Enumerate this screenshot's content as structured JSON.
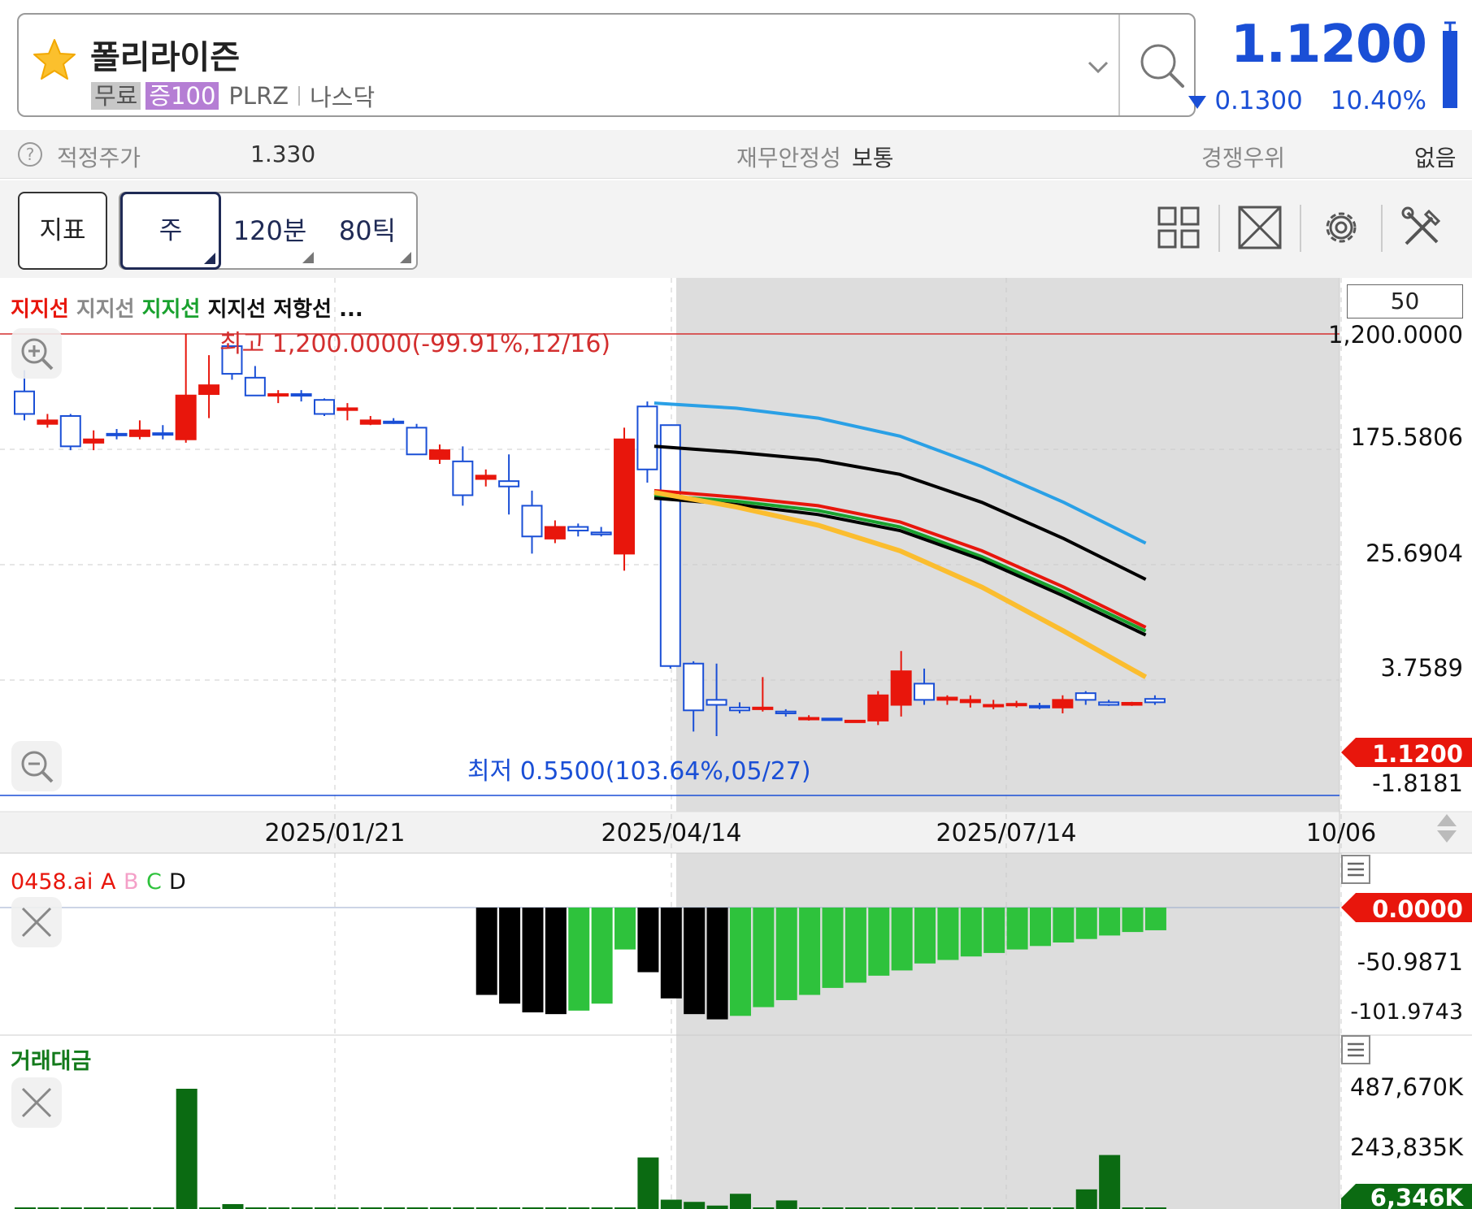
{
  "header": {
    "stock_name": "폴리라이즌",
    "tag_free": "무료",
    "tag_margin": "증100",
    "ticker": "PLRZ",
    "exchange": "나스닥",
    "price": "1.1200",
    "change": "0.1300",
    "change_pct": "10.40%",
    "price_color": "#1a4fd6"
  },
  "info_bar": {
    "fair_price_label": "적정주가",
    "fair_price_value": "1.330",
    "stability_label": "재무안정성",
    "stability_value": "보통",
    "competitive_label": "경쟁우위",
    "competitive_value": "없음"
  },
  "toolbar": {
    "indicator_label": "지표",
    "period_week": "주",
    "period_120min": "120분",
    "period_80tick": "80틱"
  },
  "chart": {
    "legend": [
      {
        "text": "지지선",
        "color": "#e8160c"
      },
      {
        "text": "지지선",
        "color": "#8a8a8a"
      },
      {
        "text": "지지선",
        "color": "#19a12e"
      },
      {
        "text": "지지선",
        "color": "#111111"
      },
      {
        "text": "저항선",
        "color": "#111111"
      },
      {
        "text": "...",
        "color": "#111111"
      }
    ],
    "ma_period": "50",
    "high_label": "최고 1,200.0000(-99.91%,12/16)",
    "low_label": "최저 0.5500(103.64%,05/27)",
    "y_labels": [
      "1,200.0000",
      "175.5806",
      "25.6904",
      "3.7589",
      "-1.8181"
    ],
    "current_price_tag": "1.1200",
    "x_labels": [
      "2025/01/21",
      "2025/04/14",
      "2025/07/14",
      "10/06"
    ]
  },
  "indicator_panel": {
    "name": "0458.ai",
    "series": [
      {
        "text": "A",
        "color": "#e8160c"
      },
      {
        "text": "B",
        "color": "#f4a0c8"
      },
      {
        "text": "C",
        "color": "#2ec23c"
      },
      {
        "text": "D",
        "color": "#111111"
      }
    ],
    "value_tag": "0.0000",
    "y_labels": [
      "-50.9871",
      "-101.9743"
    ]
  },
  "volume_panel": {
    "name": "거래대금",
    "y_labels": [
      "487,670K",
      "243,835K"
    ],
    "value_tag": "6,346K"
  },
  "chart_data": {
    "type": "bar",
    "title": "",
    "y_scale": "log",
    "candles": [
      {
        "o": 400,
        "h": 600,
        "l": 230,
        "c": 260,
        "up": false
      },
      {
        "o": 230,
        "h": 260,
        "l": 200,
        "c": 215,
        "up": true
      },
      {
        "o": 250,
        "h": 260,
        "l": 130,
        "c": 140,
        "up": false
      },
      {
        "o": 160,
        "h": 190,
        "l": 130,
        "c": 150,
        "up": true
      },
      {
        "o": 175,
        "h": 195,
        "l": 160,
        "c": 178,
        "up": false
      },
      {
        "o": 170,
        "h": 230,
        "l": 160,
        "c": 190,
        "up": true
      },
      {
        "o": 178,
        "h": 210,
        "l": 160,
        "c": 180,
        "up": false
      },
      {
        "o": 160,
        "h": 1200,
        "l": 150,
        "c": 370,
        "up": true
      },
      {
        "o": 380,
        "h": 800,
        "l": 240,
        "c": 450,
        "up": true
      },
      {
        "o": 560,
        "h": 800,
        "l": 500,
        "c": 950,
        "up": false
      },
      {
        "o": 520,
        "h": 650,
        "l": 420,
        "c": 370,
        "up": false
      },
      {
        "o": 380,
        "h": 410,
        "l": 320,
        "c": 370,
        "up": true
      },
      {
        "o": 380,
        "h": 410,
        "l": 330,
        "c": 375,
        "up": false
      },
      {
        "o": 340,
        "h": 350,
        "l": 250,
        "c": 260,
        "up": false
      },
      {
        "o": 280,
        "h": 320,
        "l": 230,
        "c": 290,
        "up": true
      },
      {
        "o": 230,
        "h": 250,
        "l": 210,
        "c": 215,
        "up": true
      },
      {
        "o": 225,
        "h": 240,
        "l": 215,
        "c": 222,
        "up": false
      },
      {
        "o": 200,
        "h": 215,
        "l": 120,
        "c": 120,
        "up": false
      },
      {
        "o": 130,
        "h": 145,
        "l": 100,
        "c": 110,
        "up": true
      },
      {
        "o": 105,
        "h": 140,
        "l": 45,
        "c": 55,
        "up": false
      },
      {
        "o": 80,
        "h": 90,
        "l": 65,
        "c": 75,
        "up": true
      },
      {
        "o": 72,
        "h": 120,
        "l": 38,
        "c": 65,
        "up": false
      },
      {
        "o": 45,
        "h": 60,
        "l": 18,
        "c": 25,
        "up": false
      },
      {
        "o": 30,
        "h": 34,
        "l": 22,
        "c": 24,
        "up": true
      },
      {
        "o": 30,
        "h": 32,
        "l": 25,
        "c": 28,
        "up": false
      },
      {
        "o": 27,
        "h": 30,
        "l": 25,
        "c": 26,
        "up": false
      },
      {
        "o": 18,
        "h": 200,
        "l": 13,
        "c": 160,
        "up": true
      },
      {
        "o": 90,
        "h": 330,
        "l": 70,
        "c": 300,
        "up": false
      },
      {
        "o": 210,
        "h": 210,
        "l": 2.0,
        "c": 2.1,
        "up": false
      },
      {
        "o": 2.2,
        "h": 2.3,
        "l": 0.6,
        "c": 0.9,
        "up": false
      },
      {
        "o": 1.1,
        "h": 2.2,
        "l": 0.55,
        "c": 1.0,
        "up": false
      },
      {
        "o": 0.95,
        "h": 1.05,
        "l": 0.85,
        "c": 0.9,
        "up": false
      },
      {
        "o": 0.95,
        "h": 1.7,
        "l": 0.88,
        "c": 0.92,
        "up": true
      },
      {
        "o": 0.85,
        "h": 0.92,
        "l": 0.8,
        "c": 0.88,
        "up": false
      },
      {
        "o": 0.78,
        "h": 0.82,
        "l": 0.74,
        "c": 0.76,
        "up": true
      },
      {
        "o": 0.76,
        "h": 0.78,
        "l": 0.74,
        "c": 0.77,
        "up": false
      },
      {
        "o": 0.74,
        "h": 0.75,
        "l": 0.72,
        "c": 0.74,
        "up": true
      },
      {
        "o": 0.74,
        "h": 1.3,
        "l": 0.68,
        "c": 1.2,
        "up": true
      },
      {
        "o": 1.0,
        "h": 2.8,
        "l": 0.8,
        "c": 1.9,
        "up": true
      },
      {
        "o": 1.5,
        "h": 2.0,
        "l": 1.0,
        "c": 1.1,
        "up": false
      },
      {
        "o": 1.1,
        "h": 1.2,
        "l": 1.0,
        "c": 1.15,
        "up": true
      },
      {
        "o": 1.05,
        "h": 1.2,
        "l": 0.95,
        "c": 1.1,
        "up": true
      },
      {
        "o": 1.0,
        "h": 1.1,
        "l": 0.92,
        "c": 1.0,
        "up": true
      },
      {
        "o": 1.0,
        "h": 1.08,
        "l": 0.95,
        "c": 1.02,
        "up": true
      },
      {
        "o": 0.98,
        "h": 1.04,
        "l": 0.92,
        "c": 0.95,
        "up": false
      },
      {
        "o": 0.95,
        "h": 1.2,
        "l": 0.85,
        "c": 1.1,
        "up": true
      },
      {
        "o": 1.1,
        "h": 1.3,
        "l": 1.0,
        "c": 1.25,
        "up": false
      },
      {
        "o": 1.05,
        "h": 1.1,
        "l": 0.98,
        "c": 1.0,
        "up": false
      },
      {
        "o": 1.0,
        "h": 1.06,
        "l": 0.98,
        "c": 1.04,
        "up": true
      },
      {
        "o": 1.05,
        "h": 1.2,
        "l": 1.0,
        "c": 1.12,
        "up": false
      }
    ],
    "ma_lines": [
      {
        "color": "#2aa0e6",
        "values": [
          320,
          290,
          240,
          170,
          95,
          48,
          22
        ]
      },
      {
        "color": "#000000",
        "values": [
          140,
          125,
          108,
          82,
          48,
          24,
          11
        ]
      },
      {
        "color": "#e8160c",
        "values": [
          60,
          53,
          45,
          33,
          19,
          9.5,
          4.4
        ]
      },
      {
        "color": "#19a12e",
        "values": [
          55,
          49,
          41,
          30,
          17,
          8.6,
          4.1
        ]
      },
      {
        "color": "#000000",
        "values": [
          52,
          46,
          38,
          28,
          16,
          8,
          3.8
        ]
      },
      {
        "color": "#fbbd2f",
        "values": [
          58,
          44,
          31,
          19,
          9.5,
          4.1,
          1.7
        ]
      }
    ],
    "oscillator": [
      null,
      null,
      null,
      null,
      null,
      null,
      null,
      null,
      null,
      null,
      null,
      null,
      null,
      null,
      null,
      null,
      null,
      null,
      null,
      null,
      -50,
      -55,
      -60,
      -61,
      -59,
      -55,
      -24,
      -37,
      -52,
      -61,
      -64,
      -62,
      -57,
      -53,
      -50,
      -46,
      -43,
      -39,
      -36,
      -32,
      -30,
      -28,
      -26,
      -24,
      -22,
      -20,
      -18,
      -16,
      -14,
      -13
    ],
    "oscillator_up": [
      false,
      false,
      false,
      false,
      false,
      false,
      false,
      false,
      false,
      false,
      false,
      false,
      false,
      false,
      false,
      false,
      false,
      false,
      false,
      false,
      false,
      false,
      false,
      false,
      true,
      true,
      true,
      false,
      false,
      false,
      false,
      true,
      true,
      true,
      true,
      true,
      true,
      true,
      true,
      true,
      true,
      true,
      true,
      true,
      true,
      true,
      true,
      true,
      true,
      true
    ],
    "volume": [
      3,
      2,
      2,
      3,
      2,
      2,
      2,
      490,
      4,
      20,
      3,
      2,
      2,
      2,
      2,
      2,
      2,
      2,
      2,
      3,
      4,
      2,
      3,
      2,
      2,
      3,
      2,
      210,
      38,
      29,
      14,
      62,
      3,
      35,
      2,
      2,
      2,
      2,
      2,
      2,
      2,
      2,
      2,
      2,
      2,
      4,
      80,
      220,
      5,
      4
    ]
  }
}
